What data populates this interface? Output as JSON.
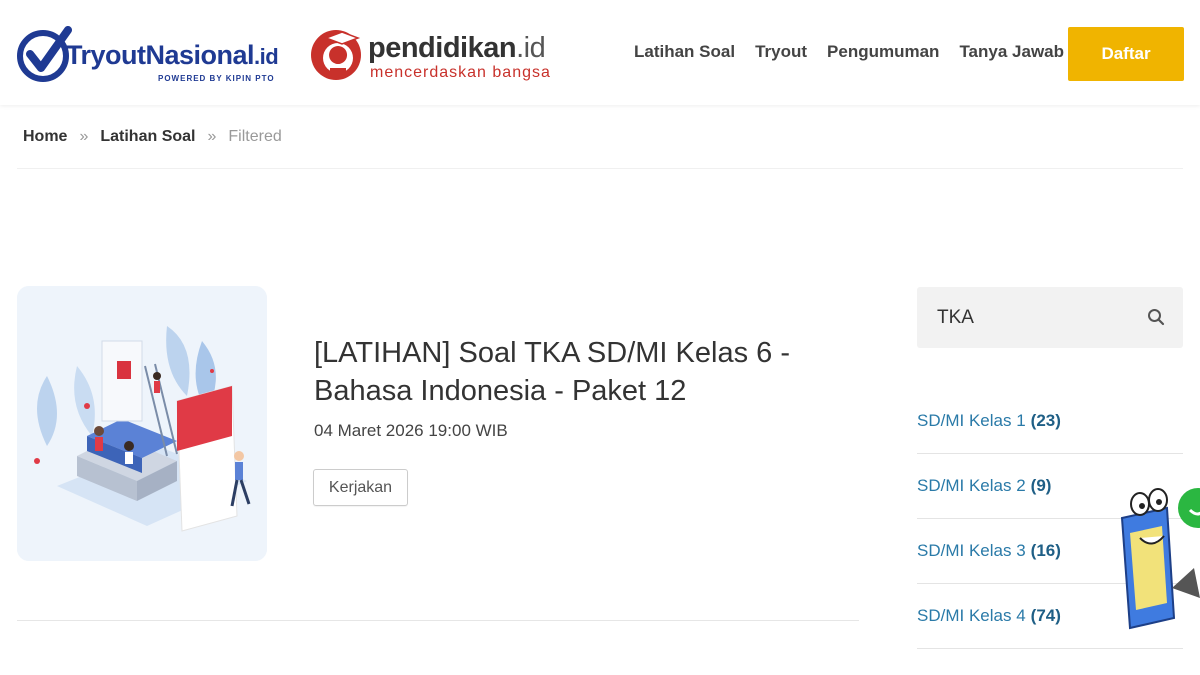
{
  "header": {
    "logo_primary": {
      "text": "TryoutNasional",
      "suffix": ".id",
      "powered": "POWERED BY KIPIN PTO"
    },
    "logo_partner": {
      "name": "pendidikan",
      "suffix": ".id",
      "tagline": "mencerdaskan bangsa"
    },
    "nav": [
      {
        "label": "Latihan Soal"
      },
      {
        "label": "Tryout"
      },
      {
        "label": "Pengumuman"
      },
      {
        "label": "Tanya Jawab"
      }
    ],
    "cta_label": "Daftar"
  },
  "breadcrumb": {
    "items": [
      "Home",
      "Latihan Soal"
    ],
    "separator": "»",
    "current": "Filtered"
  },
  "post": {
    "title": "[LATIHAN] Soal TKA SD/MI Kelas 6 - Bahasa Indonesia - Paket 12",
    "date": "04 Maret 2026 19:00 WIB",
    "action_label": "Kerjakan"
  },
  "sidebar": {
    "search_value": "TKA",
    "categories": [
      {
        "label": "SD/MI Kelas 1",
        "count": "(23)"
      },
      {
        "label": "SD/MI Kelas 2",
        "count": "(9)"
      },
      {
        "label": "SD/MI Kelas 3",
        "count": "(16)"
      },
      {
        "label": "SD/MI Kelas 4",
        "count": "(74)"
      }
    ]
  },
  "colors": {
    "brand_blue": "#1f3a93",
    "partner_red": "#c8312b",
    "cta_yellow": "#f0b400",
    "link_teal": "#2a7aa8"
  },
  "icons": [
    "checkmark-logo-icon",
    "graduate-head-icon",
    "search-icon",
    "mascot-chat-icon",
    "whatsapp-icon"
  ]
}
